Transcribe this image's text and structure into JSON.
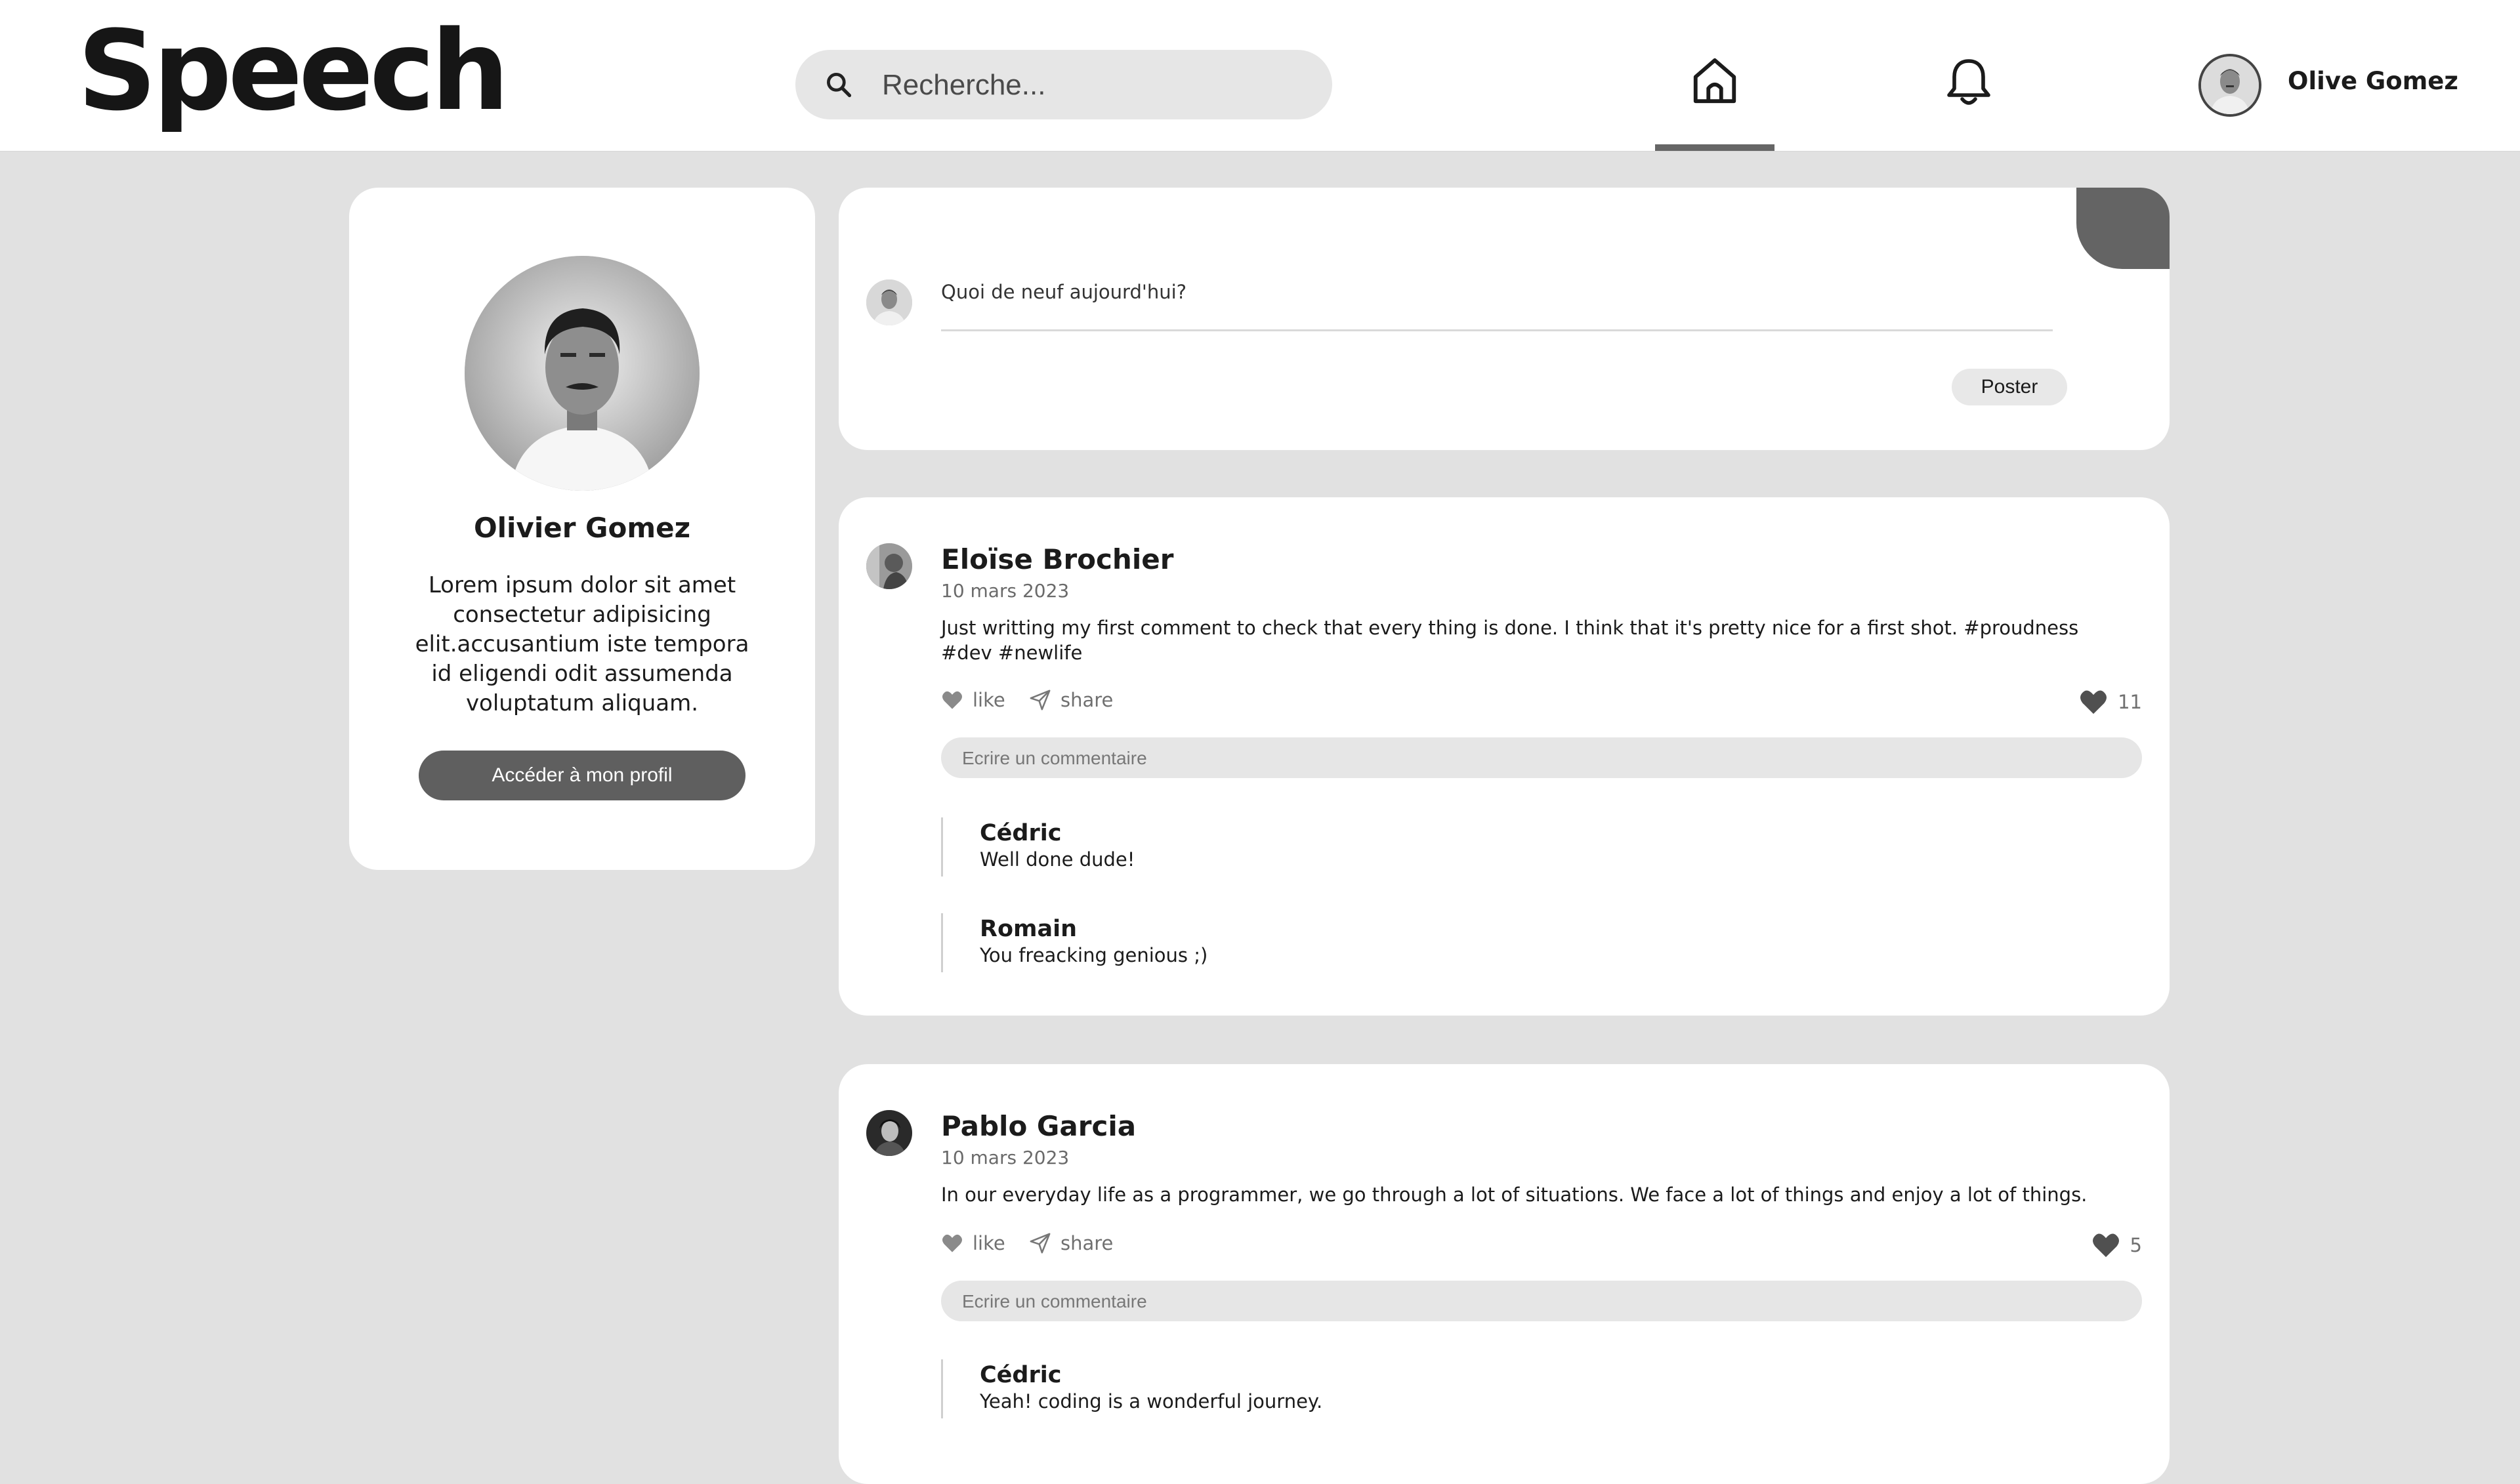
{
  "header": {
    "logo": "Speech",
    "search_placeholder": "Recherche...",
    "user_name": "Olive Gomez"
  },
  "profile": {
    "name": "Olivier Gomez",
    "bio": "Lorem ipsum dolor sit amet consectetur adipisicing elit.accusantium iste tempora id eligendi odit assumenda voluptatum aliquam.",
    "button_label": "Accéder à mon profil"
  },
  "composer": {
    "prompt": "Quoi de neuf aujourd'hui?",
    "post_label": "Poster"
  },
  "labels": {
    "like": "like",
    "share": "share",
    "comment_placeholder": "Ecrire un commentaire"
  },
  "posts": [
    {
      "author": "Eloïse Brochier",
      "date": "10 mars 2023",
      "text": "Just writting my first comment to check that every thing is done. I think that it's pretty nice for a first shot. #proudness #dev #newlife",
      "likes": "11",
      "comments": [
        {
          "name": "Cédric",
          "text": "Well done dude!"
        },
        {
          "name": "Romain",
          "text": "You freacking genious ;)"
        }
      ]
    },
    {
      "author": "Pablo Garcia",
      "date": "10 mars 2023",
      "text": "In our everyday life as a programmer, we go through a lot of situations. We face a lot of things and enjoy a lot of things.",
      "likes": "5",
      "comments": [
        {
          "name": "Cédric",
          "text": "Yeah! coding is a wonderful journey."
        }
      ]
    }
  ],
  "colors": {
    "background": "#e1e1e1",
    "accent": "#5f5f5f",
    "card": "#ffffff"
  }
}
